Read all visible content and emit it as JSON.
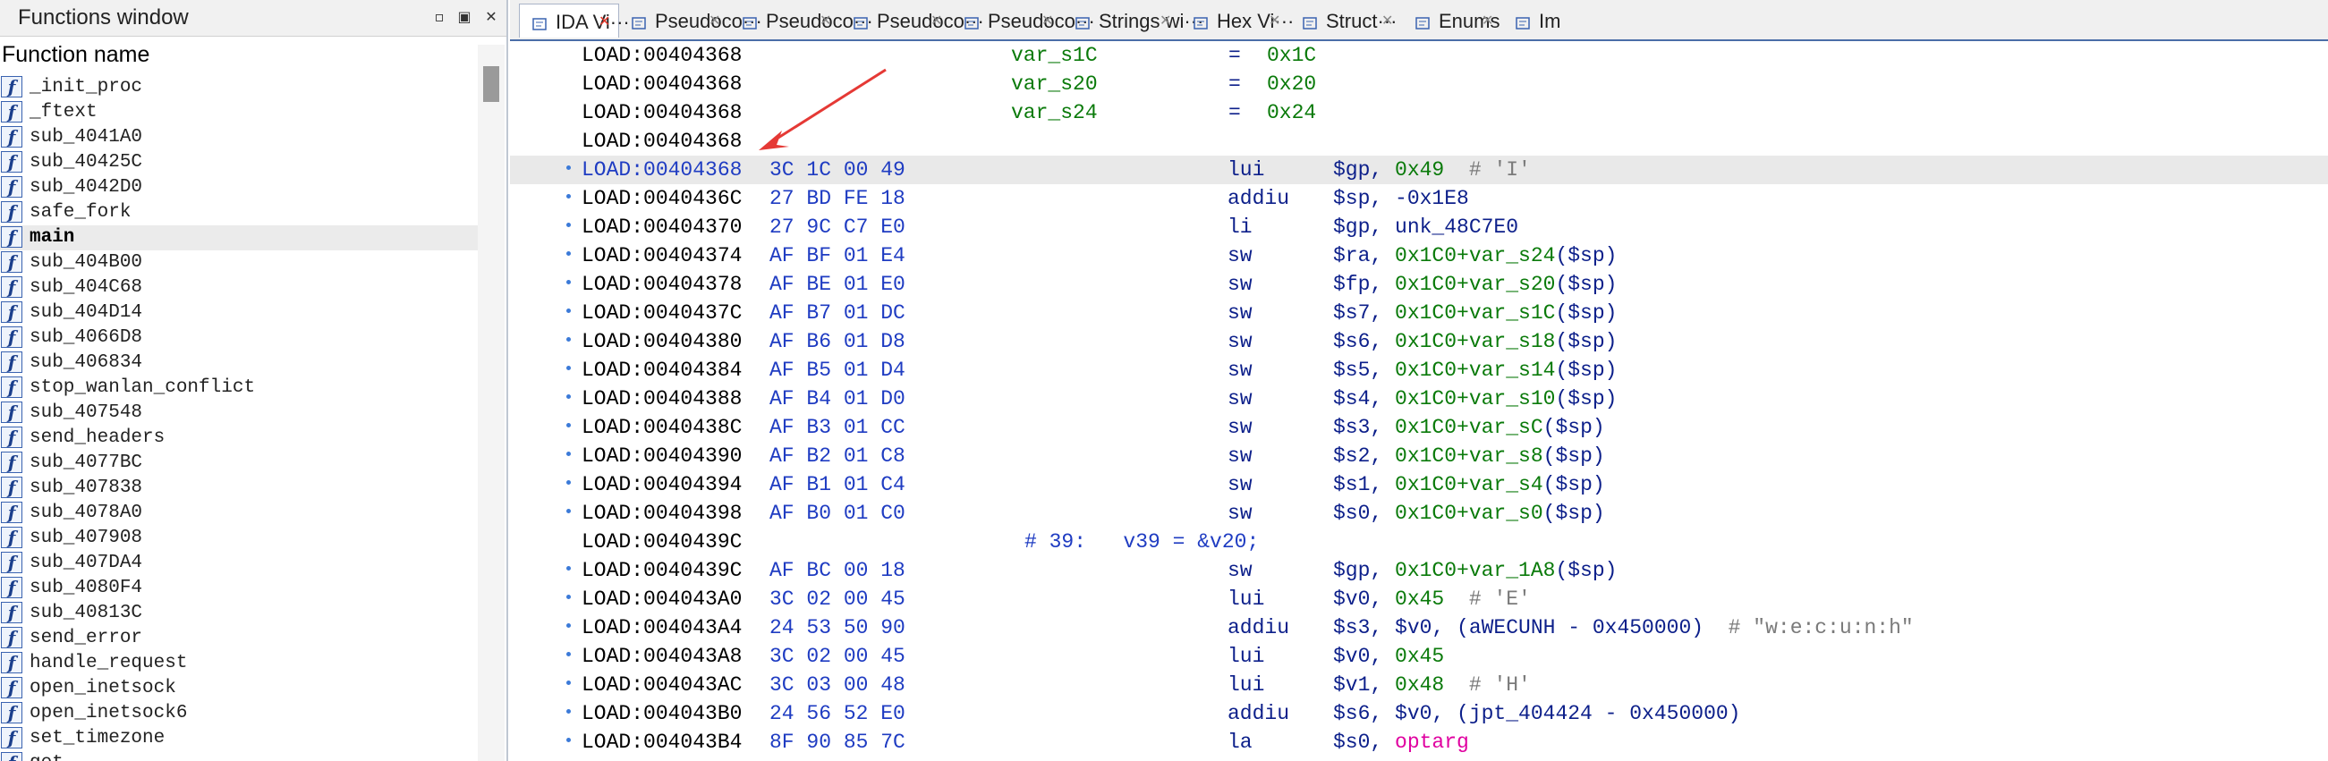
{
  "functions_window": {
    "title": "Functions window",
    "controls": [
      "▫",
      "▣",
      "✕"
    ],
    "column_header": "Function name",
    "icon_glyph": "f",
    "functions": [
      "_init_proc",
      "_ftext",
      "sub_4041A0",
      "sub_40425C",
      "sub_4042D0",
      "safe_fork",
      "main",
      "sub_404B00",
      "sub_404C68",
      "sub_404D14",
      "sub_4066D8",
      "sub_406834",
      "stop_wanlan_conflict",
      "sub_407548",
      "send_headers",
      "sub_4077BC",
      "sub_407838",
      "sub_4078A0",
      "sub_407908",
      "sub_407DA4",
      "sub_4080F4",
      "sub_40813C",
      "send_error",
      "handle_request",
      "open_inetsock",
      "open_inetsock6",
      "set_timezone",
      "get_"
    ],
    "selected": "main"
  },
  "tabs": [
    {
      "label": "IDA Vi···",
      "icon": "ida-view-icon",
      "active": true
    },
    {
      "label": "Pseudoco···",
      "icon": "pseudocode-icon",
      "active": false
    },
    {
      "label": "Pseudoco···",
      "icon": "pseudocode-icon",
      "active": false
    },
    {
      "label": "Pseudoco···",
      "icon": "pseudocode-icon",
      "active": false
    },
    {
      "label": "Pseudoco···",
      "icon": "pseudocode-icon",
      "active": false
    },
    {
      "label": "Strings wi···",
      "icon": "strings-icon",
      "active": false
    },
    {
      "label": "Hex Vi···",
      "icon": "hex-view-icon",
      "active": false
    },
    {
      "label": "Struct···",
      "icon": "structures-icon",
      "active": false
    },
    {
      "label": "Enums",
      "icon": "enums-icon",
      "active": false
    },
    {
      "label": "Im",
      "icon": "imports-icon",
      "active": false
    }
  ],
  "tab_close": "✕",
  "disassembly": [
    {
      "addr": "LOAD:00404368",
      "kind": "equ",
      "name": "var_s1C",
      "eq": "=",
      "val": "0x1C"
    },
    {
      "addr": "LOAD:00404368",
      "kind": "equ",
      "name": "var_s20",
      "eq": "=",
      "val": "0x20"
    },
    {
      "addr": "LOAD:00404368",
      "kind": "equ",
      "name": "var_s24",
      "eq": "=",
      "val": "0x24"
    },
    {
      "addr": "LOAD:00404368",
      "kind": "blank"
    },
    {
      "addr": "LOAD:00404368",
      "kind": "ins",
      "hl": true,
      "blue": true,
      "bytes": "3C 1C 00 49",
      "mn": "lui",
      "ops": [
        [
          "reg",
          "$gp, "
        ],
        [
          "num",
          "0x49"
        ],
        [
          "cmt",
          "  # 'I'"
        ]
      ]
    },
    {
      "addr": "LOAD:0040436C",
      "kind": "ins",
      "bytes": "27 BD FE 18",
      "mn": "addiu",
      "ops": [
        [
          "reg",
          "$sp, -0x1E8"
        ]
      ]
    },
    {
      "addr": "LOAD:00404370",
      "kind": "ins",
      "bytes": "27 9C C7 E0",
      "mn": "li",
      "ops": [
        [
          "reg",
          "$gp, unk_48C7E0"
        ]
      ]
    },
    {
      "addr": "LOAD:00404374",
      "kind": "ins",
      "bytes": "AF BF 01 E4",
      "mn": "sw",
      "ops": [
        [
          "reg",
          "$ra, "
        ],
        [
          "var",
          "0x1C0+var_s24"
        ],
        [
          "reg",
          "($sp)"
        ]
      ]
    },
    {
      "addr": "LOAD:00404378",
      "kind": "ins",
      "bytes": "AF BE 01 E0",
      "mn": "sw",
      "ops": [
        [
          "reg",
          "$fp, "
        ],
        [
          "var",
          "0x1C0+var_s20"
        ],
        [
          "reg",
          "($sp)"
        ]
      ]
    },
    {
      "addr": "LOAD:0040437C",
      "kind": "ins",
      "bytes": "AF B7 01 DC",
      "mn": "sw",
      "ops": [
        [
          "reg",
          "$s7, "
        ],
        [
          "var",
          "0x1C0+var_s1C"
        ],
        [
          "reg",
          "($sp)"
        ]
      ]
    },
    {
      "addr": "LOAD:00404380",
      "kind": "ins",
      "bytes": "AF B6 01 D8",
      "mn": "sw",
      "ops": [
        [
          "reg",
          "$s6, "
        ],
        [
          "var",
          "0x1C0+var_s18"
        ],
        [
          "reg",
          "($sp)"
        ]
      ]
    },
    {
      "addr": "LOAD:00404384",
      "kind": "ins",
      "bytes": "AF B5 01 D4",
      "mn": "sw",
      "ops": [
        [
          "reg",
          "$s5, "
        ],
        [
          "var",
          "0x1C0+var_s14"
        ],
        [
          "reg",
          "($sp)"
        ]
      ]
    },
    {
      "addr": "LOAD:00404388",
      "kind": "ins",
      "bytes": "AF B4 01 D0",
      "mn": "sw",
      "ops": [
        [
          "reg",
          "$s4, "
        ],
        [
          "var",
          "0x1C0+var_s10"
        ],
        [
          "reg",
          "($sp)"
        ]
      ]
    },
    {
      "addr": "LOAD:0040438C",
      "kind": "ins",
      "bytes": "AF B3 01 CC",
      "mn": "sw",
      "ops": [
        [
          "reg",
          "$s3, "
        ],
        [
          "var",
          "0x1C0+var_sC"
        ],
        [
          "reg",
          "($sp)"
        ]
      ]
    },
    {
      "addr": "LOAD:00404390",
      "kind": "ins",
      "bytes": "AF B2 01 C8",
      "mn": "sw",
      "ops": [
        [
          "reg",
          "$s2, "
        ],
        [
          "var",
          "0x1C0+var_s8"
        ],
        [
          "reg",
          "($sp)"
        ]
      ]
    },
    {
      "addr": "LOAD:00404394",
      "kind": "ins",
      "bytes": "AF B1 01 C4",
      "mn": "sw",
      "ops": [
        [
          "reg",
          "$s1, "
        ],
        [
          "var",
          "0x1C0+var_s4"
        ],
        [
          "reg",
          "($sp)"
        ]
      ]
    },
    {
      "addr": "LOAD:00404398",
      "kind": "ins",
      "bytes": "AF B0 01 C0",
      "mn": "sw",
      "ops": [
        [
          "reg",
          "$s0, "
        ],
        [
          "var",
          "0x1C0+var_s0"
        ],
        [
          "reg",
          "($sp)"
        ]
      ]
    },
    {
      "addr": "LOAD:0040439C",
      "kind": "pseudo",
      "text": "# 39:   v39 = &v20;"
    },
    {
      "addr": "LOAD:0040439C",
      "kind": "ins",
      "bytes": "AF BC 00 18",
      "mn": "sw",
      "ops": [
        [
          "reg",
          "$gp, "
        ],
        [
          "var",
          "0x1C0+var_1A8"
        ],
        [
          "reg",
          "($sp)"
        ]
      ]
    },
    {
      "addr": "LOAD:004043A0",
      "kind": "ins",
      "bytes": "3C 02 00 45",
      "mn": "lui",
      "ops": [
        [
          "reg",
          "$v0, "
        ],
        [
          "num",
          "0x45"
        ],
        [
          "cmt",
          "  # 'E'"
        ]
      ]
    },
    {
      "addr": "LOAD:004043A4",
      "kind": "ins",
      "bytes": "24 53 50 90",
      "mn": "addiu",
      "ops": [
        [
          "reg",
          "$s3, $v0, (aWECUNH - 0x450000)"
        ],
        [
          "str",
          "  # \"w:e:c:u:n:h\""
        ]
      ]
    },
    {
      "addr": "LOAD:004043A8",
      "kind": "ins",
      "bytes": "3C 02 00 45",
      "mn": "lui",
      "ops": [
        [
          "reg",
          "$v0, "
        ],
        [
          "num",
          "0x45"
        ]
      ]
    },
    {
      "addr": "LOAD:004043AC",
      "kind": "ins",
      "bytes": "3C 03 00 48",
      "mn": "lui",
      "ops": [
        [
          "reg",
          "$v1, "
        ],
        [
          "num",
          "0x48"
        ],
        [
          "cmt",
          "  # 'H'"
        ]
      ]
    },
    {
      "addr": "LOAD:004043B0",
      "kind": "ins",
      "bytes": "24 56 52 E0",
      "mn": "addiu",
      "ops": [
        [
          "reg",
          "$s6, $v0, (jpt_404424 - 0x450000)"
        ]
      ]
    },
    {
      "addr": "LOAD:004043B4",
      "kind": "ins",
      "bytes": "8F 90 85 7C",
      "mn": "la",
      "ops": [
        [
          "reg",
          "$s0, "
        ],
        [
          "mag",
          "optarg"
        ]
      ]
    }
  ],
  "annotation_arrow": {
    "color": "#e53935"
  }
}
